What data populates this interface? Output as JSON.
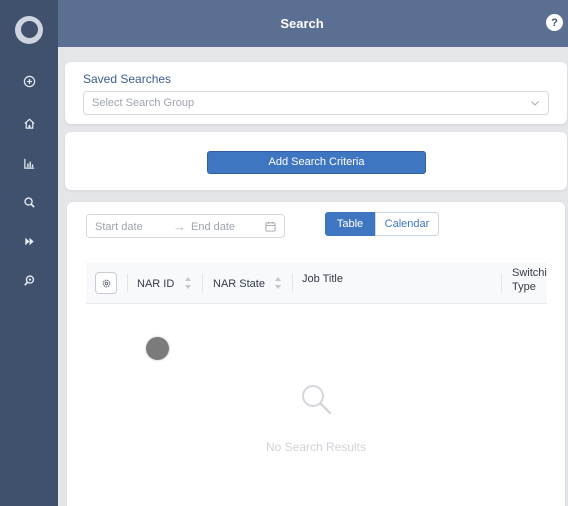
{
  "header": {
    "title": "Search",
    "help_label": "?"
  },
  "sidebar": {
    "items": [
      {
        "icon": "plus-circle-icon"
      },
      {
        "icon": "home-icon"
      },
      {
        "icon": "bar-chart-icon"
      },
      {
        "icon": "search-icon"
      },
      {
        "icon": "fast-forward-icon"
      },
      {
        "icon": "zoom-search-icon"
      }
    ]
  },
  "saved_searches": {
    "label": "Saved Searches",
    "select_placeholder": "Select Search Group"
  },
  "criteria": {
    "add_button_label": "Add Search Criteria"
  },
  "results": {
    "date_start_placeholder": "Start date",
    "date_arrow": "→",
    "date_end_placeholder": "End date",
    "view_toggle": {
      "table_label": "Table",
      "calendar_label": "Calendar",
      "selected": "Table"
    },
    "columns": [
      "NAR ID",
      "NAR State",
      "Job Title",
      "Switchi Type"
    ],
    "empty_text": "No Search Results"
  },
  "colors": {
    "sidebar": "#3f516d",
    "header": "#5a6f92",
    "accent": "#3f76c1"
  }
}
